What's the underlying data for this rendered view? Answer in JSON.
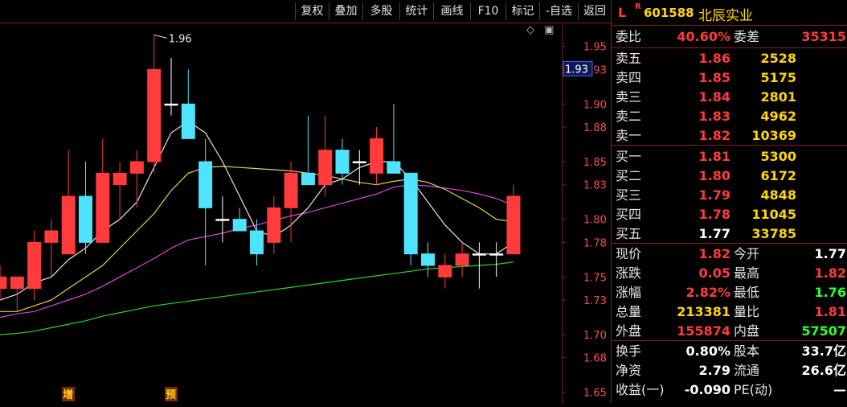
{
  "toolbar": {
    "buttons": [
      "复权",
      "叠加",
      "多股",
      "统计",
      "画线",
      "F10",
      "标记",
      "-自选",
      "返回"
    ]
  },
  "chart_corner": {
    "diamond": "◇",
    "square": "▣"
  },
  "colors": {
    "up": "#ff3b3b",
    "down": "#4fe3ff",
    "ma5": "#e6e6e6",
    "ma10": "#e8d24a",
    "ma20": "#e040e0",
    "ma60": "#27d827",
    "grid": "#5a1414",
    "axis": "#8a1c1c"
  },
  "chart_data": {
    "type": "candlestick",
    "ylim": [
      1.64,
      1.97
    ],
    "y_ticks": [
      "1.95",
      "1.93",
      "1.90",
      "1.88",
      "1.85",
      "1.83",
      "1.80",
      "1.78",
      "1.75",
      "1.73",
      "1.70",
      "1.68",
      "1.65"
    ],
    "current_price_label": "1.93",
    "peak_annotation": "1.96",
    "candles": [
      {
        "o": 1.74,
        "h": 1.76,
        "l": 1.73,
        "c": 1.75
      },
      {
        "o": 1.74,
        "h": 1.75,
        "l": 1.72,
        "c": 1.75
      },
      {
        "o": 1.74,
        "h": 1.79,
        "l": 1.73,
        "c": 1.78
      },
      {
        "o": 1.78,
        "h": 1.8,
        "l": 1.75,
        "c": 1.79
      },
      {
        "o": 1.77,
        "h": 1.86,
        "l": 1.77,
        "c": 1.82
      },
      {
        "o": 1.82,
        "h": 1.85,
        "l": 1.77,
        "c": 1.78
      },
      {
        "o": 1.78,
        "h": 1.87,
        "l": 1.78,
        "c": 1.84
      },
      {
        "o": 1.83,
        "h": 1.85,
        "l": 1.8,
        "c": 1.84
      },
      {
        "o": 1.84,
        "h": 1.86,
        "l": 1.81,
        "c": 1.85
      },
      {
        "o": 1.85,
        "h": 1.96,
        "l": 1.84,
        "c": 1.93
      },
      {
        "o": 1.9,
        "h": 1.94,
        "l": 1.89,
        "c": 1.9
      },
      {
        "o": 1.9,
        "h": 1.93,
        "l": 1.87,
        "c": 1.87
      },
      {
        "o": 1.85,
        "h": 1.87,
        "l": 1.76,
        "c": 1.81
      },
      {
        "o": 1.8,
        "h": 1.82,
        "l": 1.78,
        "c": 1.8
      },
      {
        "o": 1.8,
        "h": 1.81,
        "l": 1.79,
        "c": 1.79
      },
      {
        "o": 1.79,
        "h": 1.8,
        "l": 1.76,
        "c": 1.77
      },
      {
        "o": 1.78,
        "h": 1.82,
        "l": 1.77,
        "c": 1.81
      },
      {
        "o": 1.81,
        "h": 1.85,
        "l": 1.78,
        "c": 1.84
      },
      {
        "o": 1.84,
        "h": 1.89,
        "l": 1.83,
        "c": 1.83
      },
      {
        "o": 1.83,
        "h": 1.89,
        "l": 1.82,
        "c": 1.86
      },
      {
        "o": 1.86,
        "h": 1.87,
        "l": 1.83,
        "c": 1.84
      },
      {
        "o": 1.85,
        "h": 1.86,
        "l": 1.83,
        "c": 1.85
      },
      {
        "o": 1.84,
        "h": 1.88,
        "l": 1.83,
        "c": 1.87
      },
      {
        "o": 1.85,
        "h": 1.9,
        "l": 1.84,
        "c": 1.84
      },
      {
        "o": 1.84,
        "h": 1.83,
        "l": 1.76,
        "c": 1.77
      },
      {
        "o": 1.77,
        "h": 1.78,
        "l": 1.75,
        "c": 1.76
      },
      {
        "o": 1.75,
        "h": 1.77,
        "l": 1.74,
        "c": 1.76
      },
      {
        "o": 1.76,
        "h": 1.78,
        "l": 1.75,
        "c": 1.77
      },
      {
        "o": 1.77,
        "h": 1.78,
        "l": 1.74,
        "c": 1.77
      },
      {
        "o": 1.77,
        "h": 1.78,
        "l": 1.75,
        "c": 1.77
      },
      {
        "o": 1.77,
        "h": 1.83,
        "l": 1.77,
        "c": 1.82
      }
    ],
    "ma5": [
      1.73,
      1.735,
      1.745,
      1.75,
      1.765,
      1.775,
      1.79,
      1.8,
      1.815,
      1.845,
      1.875,
      1.885,
      1.875,
      1.85,
      1.82,
      1.79,
      1.785,
      1.795,
      1.81,
      1.83,
      1.835,
      1.845,
      1.85,
      1.85,
      1.835,
      1.815,
      1.795,
      1.78,
      1.77,
      1.77,
      1.78
    ],
    "ma10": [
      1.72,
      1.72,
      1.725,
      1.73,
      1.74,
      1.75,
      1.76,
      1.775,
      1.79,
      1.805,
      1.825,
      1.84,
      1.845,
      1.846,
      1.845,
      1.844,
      1.843,
      1.842,
      1.84,
      1.838,
      1.835,
      1.832,
      1.83,
      1.833,
      1.835,
      1.832,
      1.826,
      1.818,
      1.81,
      1.8,
      1.798
    ],
    "ma20": [
      1.715,
      1.718,
      1.72,
      1.725,
      1.73,
      1.735,
      1.742,
      1.75,
      1.758,
      1.766,
      1.775,
      1.782,
      1.785,
      1.788,
      1.792,
      1.795,
      1.799,
      1.803,
      1.806,
      1.81,
      1.814,
      1.818,
      1.822,
      1.828,
      1.83,
      1.829,
      1.827,
      1.825,
      1.822,
      1.818,
      1.812
    ],
    "ma60": [
      1.7,
      1.701,
      1.703,
      1.706,
      1.709,
      1.712,
      1.716,
      1.719,
      1.722,
      1.725,
      1.727,
      1.729,
      1.731,
      1.733,
      1.735,
      1.737,
      1.739,
      1.741,
      1.743,
      1.745,
      1.747,
      1.749,
      1.751,
      1.753,
      1.755,
      1.757,
      1.758,
      1.759,
      1.76,
      1.761,
      1.763
    ],
    "markers": [
      {
        "label": "增",
        "index": 4
      },
      {
        "label": "预",
        "index": 10
      }
    ]
  },
  "quote": {
    "L": "L",
    "R": "R",
    "code": "601588",
    "name": "北辰实业",
    "weibi_label": "委比",
    "weibi_value": "40.60%",
    "weicha_label": "委差",
    "weicha_value": "35315",
    "sell": [
      {
        "label": "卖五",
        "price": "1.86",
        "vol": "2528"
      },
      {
        "label": "卖四",
        "price": "1.85",
        "vol": "5175"
      },
      {
        "label": "卖三",
        "price": "1.84",
        "vol": "2801"
      },
      {
        "label": "卖二",
        "price": "1.83",
        "vol": "4962"
      },
      {
        "label": "卖一",
        "price": "1.82",
        "vol": "10369"
      }
    ],
    "buy": [
      {
        "label": "买一",
        "price": "1.81",
        "vol": "5300"
      },
      {
        "label": "买二",
        "price": "1.80",
        "vol": "6172"
      },
      {
        "label": "买三",
        "price": "1.79",
        "vol": "4848"
      },
      {
        "label": "买四",
        "price": "1.78",
        "vol": "11045"
      },
      {
        "label": "买五",
        "price": "1.77",
        "vol": "33785"
      }
    ],
    "stats": [
      {
        "l1": "现价",
        "v1": "1.82",
        "l2": "今开",
        "v2": "1.77"
      },
      {
        "l1": "涨跌",
        "v1": "0.05",
        "l2": "最高",
        "v2": "1.82"
      },
      {
        "l1": "涨幅",
        "v1": "2.82%",
        "l2": "最低",
        "v2": "1.76"
      },
      {
        "l1": "总量",
        "v1": "213381",
        "l2": "量比",
        "v2": "1.81"
      },
      {
        "l1": "外盘",
        "v1": "155874",
        "l2": "内盘",
        "v2": "57507"
      }
    ],
    "stats2": [
      {
        "l1": "换手",
        "v1": "0.80%",
        "l2": "股本",
        "v2": "33.7亿"
      },
      {
        "l1": "净资",
        "v1": "2.79",
        "l2": "流通",
        "v2": "26.6亿"
      },
      {
        "l1": "收益(一)",
        "v1": "-0.090",
        "l2": "PE(动)",
        "v2": "—"
      }
    ]
  }
}
